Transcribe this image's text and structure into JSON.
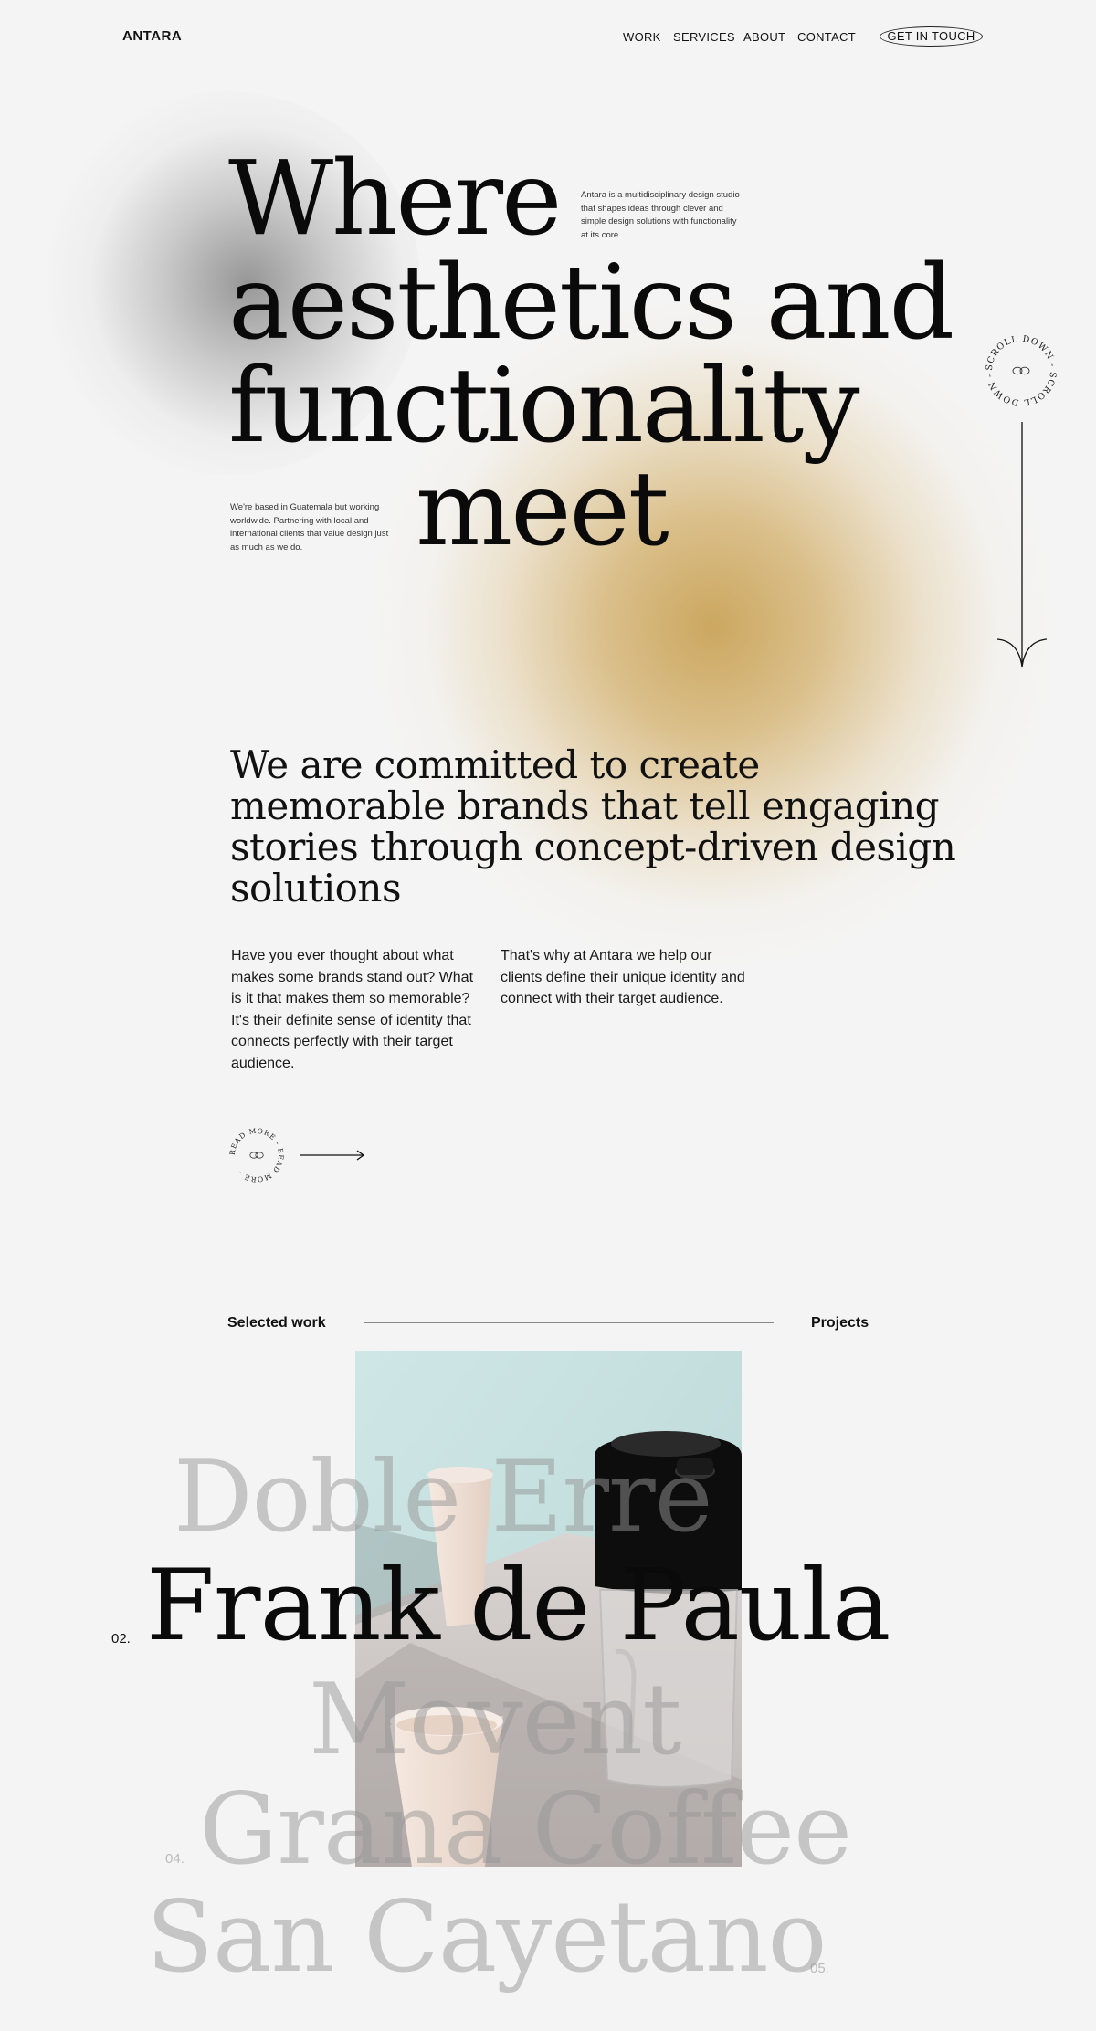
{
  "header": {
    "logo": "ANTARA",
    "nav": [
      "WORK",
      "SERVICES",
      "ABOUT",
      "CONTACT"
    ],
    "cta": "GET IN TOUCH"
  },
  "hero": {
    "lines": [
      "Where",
      "aesthetics and",
      "functionality",
      "meet"
    ],
    "intro": "Antara is a multidisciplinary design studio that shapes ideas through clever and simple design solutions with functionality at its core.",
    "location": "We're based in Guatemala but working worldwide. Partnering with local and international clients that value design just as much as we do.",
    "scroll_text": "SCROLL DOWN - SCROLL DOWN - "
  },
  "about": {
    "heading": "We are committed to create memorable brands that tell engaging stories through concept-driven design solutions",
    "para1": "Have you ever thought about what makes some brands stand out? What is it that makes them so memorable? It's their definite sense of identity that connects perfectly with their target audience.",
    "para2": "That's why at Antara we help our clients define their unique identity and connect with their target audience.",
    "read_more_text": "READ MORE - READ MORE - "
  },
  "work": {
    "label": "Selected work",
    "projects_link": "Projects",
    "items": [
      {
        "name": "Doble Erre",
        "number": ""
      },
      {
        "name": "Frank de Paula",
        "number": "02."
      },
      {
        "name": "Movent",
        "number": ""
      },
      {
        "name": "Grana Coffee",
        "number": "04."
      },
      {
        "name": "San Cayetano",
        "number": "05."
      }
    ]
  },
  "colors": {
    "background": "#f4f4f4",
    "accent_gold": "#c9a358",
    "text": "#111111",
    "faded_text": "#969696"
  }
}
